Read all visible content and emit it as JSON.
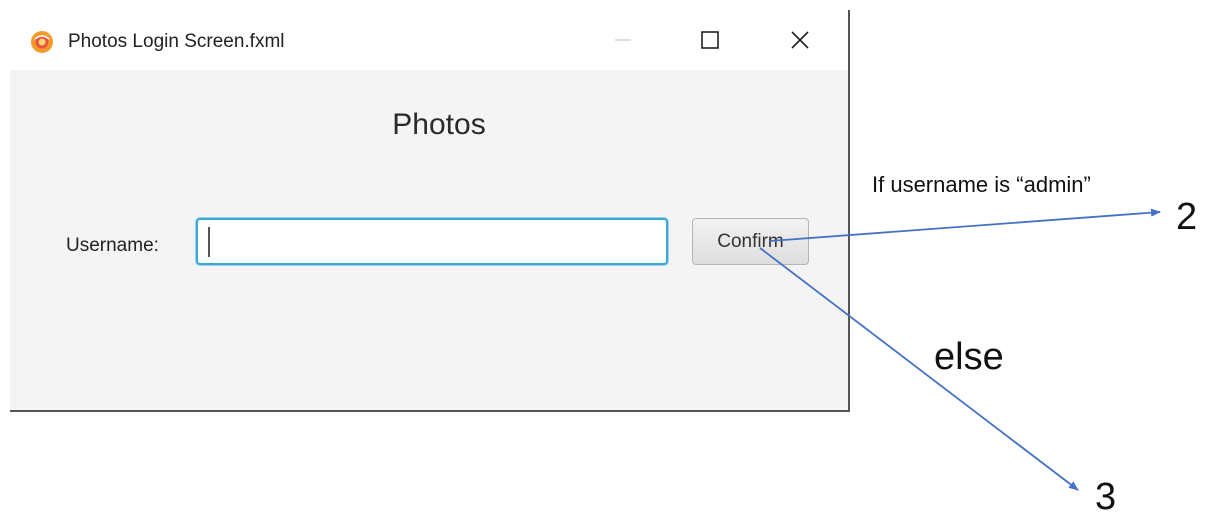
{
  "window": {
    "title": "Photos Login Screen.fxml",
    "icon": "app-logo-icon",
    "controls": [
      "minimize-icon",
      "maximize-icon",
      "close-icon"
    ]
  },
  "form": {
    "heading": "Photos",
    "username_label": "Username:",
    "username_value": "",
    "confirm_label": "Confirm"
  },
  "annotations": {
    "condition": "If username is “admin”",
    "target_admin": "2",
    "else_label": "else",
    "target_else": "3",
    "arrow_color": "#4472c4"
  },
  "colors": {
    "input_focus": "#3aa6d8",
    "window_bg": "#f4f4f4",
    "icon_orange": "#f39a2b"
  }
}
